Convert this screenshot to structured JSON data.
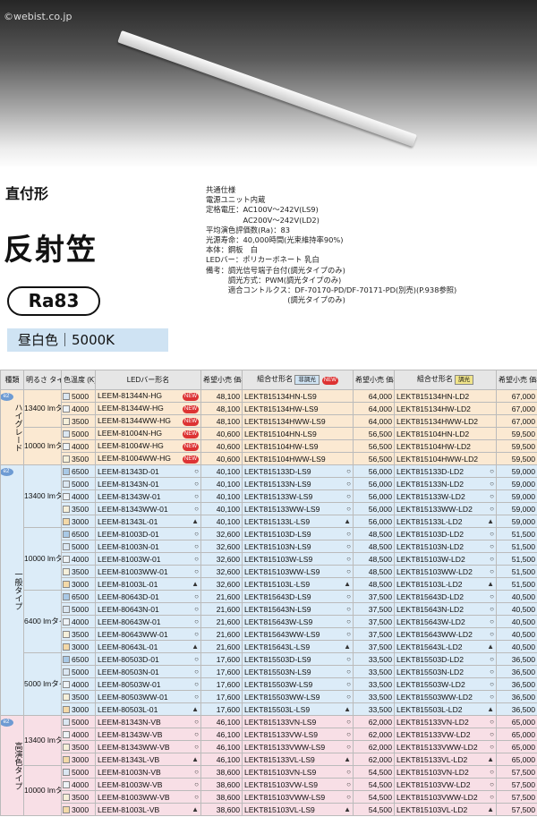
{
  "watermark": "©webist.co.jp",
  "mount_type": "直付形",
  "title": "反射笠",
  "ra": "Ra83",
  "color_label": "昼白色｜5000K",
  "specs": [
    "共通仕様",
    "電源ユニット内蔵",
    "定格電圧：AC100V～242V(LS9)",
    "　　　　　AC200V～242V(LD2)",
    "平均演色評価数(Ra)：83",
    "光源寿命：40,000時間(光束維持率90%)",
    "本体：鋼板　白",
    "LEDバー：ポリカーボネート 乳白",
    "備考：調光信号端子台付(調光タイプのみ)",
    "　　　調光方式：PWM(調光タイプのみ)",
    "　　　適合コントルクス：DF-70170-PD/DF-70171-PD(別売)(P.938参照)",
    "　　　　　　　　　　　(調光タイプのみ)"
  ],
  "headers": {
    "kind": "種類",
    "lm": "明るさ タイプ※1",
    "cct": "色温度 (K)",
    "bar": "LEDバー形名",
    "price": "希望小売 価格(円)",
    "combo": "組合せ形名",
    "nondim": "非調光",
    "new": "NEW",
    "dim": "調光"
  },
  "colors": {
    "6500": "#a9c9e6",
    "5000": "#dbe7f2",
    "4000": "#eef3f7",
    "3500": "#f6f0da",
    "3000": "#f4d9a8"
  },
  "rows": [
    {
      "cct": "5000",
      "bar": "LEEM-81344N-HG",
      "m": "new",
      "p1": "48,100",
      "c1": "LEKT815134HN-LS9",
      "p2": "64,000",
      "c2": "LEKT815134HN-LD2",
      "p3": "67,000"
    },
    {
      "cct": "4000",
      "bar": "LEEM-81344W-HG",
      "m": "new",
      "p1": "48,100",
      "c1": "LEKT815134HW-LS9",
      "p2": "64,000",
      "c2": "LEKT815134HW-LD2",
      "p3": "67,000"
    },
    {
      "cct": "3500",
      "bar": "LEEM-81344WW-HG",
      "m": "new",
      "p1": "48,100",
      "c1": "LEKT815134HWW-LS9",
      "p2": "64,000",
      "c2": "LEKT815134HWW-LD2",
      "p3": "67,000"
    },
    {
      "cct": "5000",
      "bar": "LEEM-81004N-HG",
      "m": "new",
      "p1": "40,600",
      "c1": "LEKT815104HN-LS9",
      "p2": "56,500",
      "c2": "LEKT815104HN-LD2",
      "p3": "59,500"
    },
    {
      "cct": "4000",
      "bar": "LEEM-81004W-HG",
      "m": "new",
      "p1": "40,600",
      "c1": "LEKT815104HW-LS9",
      "p2": "56,500",
      "c2": "LEKT815104HW-LD2",
      "p3": "59,500"
    },
    {
      "cct": "3500",
      "bar": "LEEM-81004WW-HG",
      "m": "new",
      "p1": "40,600",
      "c1": "LEKT815104HWW-LS9",
      "p2": "56,500",
      "c2": "LEKT815104HWW-LD2",
      "p3": "59,500"
    },
    {
      "cct": "6500",
      "bar": "LEEM-81343D-01",
      "m": "○",
      "p1": "40,100",
      "c1": "LEKT815133D-LS9",
      "p2": "56,000",
      "c2": "LEKT815133D-LD2",
      "p3": "59,000"
    },
    {
      "cct": "5000",
      "bar": "LEEM-81343N-01",
      "m": "○",
      "p1": "40,100",
      "c1": "LEKT815133N-LS9",
      "p2": "56,000",
      "c2": "LEKT815133N-LD2",
      "p3": "59,000"
    },
    {
      "cct": "4000",
      "bar": "LEEM-81343W-01",
      "m": "○",
      "p1": "40,100",
      "c1": "LEKT815133W-LS9",
      "p2": "56,000",
      "c2": "LEKT815133W-LD2",
      "p3": "59,000"
    },
    {
      "cct": "3500",
      "bar": "LEEM-81343WW-01",
      "m": "○",
      "p1": "40,100",
      "c1": "LEKT815133WW-LS9",
      "p2": "56,000",
      "c2": "LEKT815133WW-LD2",
      "p3": "59,000"
    },
    {
      "cct": "3000",
      "bar": "LEEM-81343L-01",
      "m": "▲",
      "p1": "40,100",
      "c1": "LEKT815133L-LS9",
      "p2": "56,000",
      "c2": "LEKT815133L-LD2",
      "p3": "59,000"
    },
    {
      "cct": "6500",
      "bar": "LEEM-81003D-01",
      "m": "○",
      "p1": "32,600",
      "c1": "LEKT815103D-LS9",
      "p2": "48,500",
      "c2": "LEKT815103D-LD2",
      "p3": "51,500"
    },
    {
      "cct": "5000",
      "bar": "LEEM-81003N-01",
      "m": "○",
      "p1": "32,600",
      "c1": "LEKT815103N-LS9",
      "p2": "48,500",
      "c2": "LEKT815103N-LD2",
      "p3": "51,500"
    },
    {
      "cct": "4000",
      "bar": "LEEM-81003W-01",
      "m": "○",
      "p1": "32,600",
      "c1": "LEKT815103W-LS9",
      "p2": "48,500",
      "c2": "LEKT815103W-LD2",
      "p3": "51,500"
    },
    {
      "cct": "3500",
      "bar": "LEEM-81003WW-01",
      "m": "○",
      "p1": "32,600",
      "c1": "LEKT815103WW-LS9",
      "p2": "48,500",
      "c2": "LEKT815103WW-LD2",
      "p3": "51,500"
    },
    {
      "cct": "3000",
      "bar": "LEEM-81003L-01",
      "m": "▲",
      "p1": "32,600",
      "c1": "LEKT815103L-LS9",
      "p2": "48,500",
      "c2": "LEKT815103L-LD2",
      "p3": "51,500"
    },
    {
      "cct": "6500",
      "bar": "LEEM-80643D-01",
      "m": "○",
      "p1": "21,600",
      "c1": "LEKT815643D-LS9",
      "p2": "37,500",
      "c2": "LEKT815643D-LD2",
      "p3": "40,500"
    },
    {
      "cct": "5000",
      "bar": "LEEM-80643N-01",
      "m": "○",
      "p1": "21,600",
      "c1": "LEKT815643N-LS9",
      "p2": "37,500",
      "c2": "LEKT815643N-LD2",
      "p3": "40,500"
    },
    {
      "cct": "4000",
      "bar": "LEEM-80643W-01",
      "m": "○",
      "p1": "21,600",
      "c1": "LEKT815643W-LS9",
      "p2": "37,500",
      "c2": "LEKT815643W-LD2",
      "p3": "40,500"
    },
    {
      "cct": "3500",
      "bar": "LEEM-80643WW-01",
      "m": "○",
      "p1": "21,600",
      "c1": "LEKT815643WW-LS9",
      "p2": "37,500",
      "c2": "LEKT815643WW-LD2",
      "p3": "40,500"
    },
    {
      "cct": "3000",
      "bar": "LEEM-80643L-01",
      "m": "▲",
      "p1": "21,600",
      "c1": "LEKT815643L-LS9",
      "p2": "37,500",
      "c2": "LEKT815643L-LD2",
      "p3": "40,500"
    },
    {
      "cct": "6500",
      "bar": "LEEM-80503D-01",
      "m": "○",
      "p1": "17,600",
      "c1": "LEKT815503D-LS9",
      "p2": "33,500",
      "c2": "LEKT815503D-LD2",
      "p3": "36,500"
    },
    {
      "cct": "5000",
      "bar": "LEEM-80503N-01",
      "m": "○",
      "p1": "17,600",
      "c1": "LEKT815503N-LS9",
      "p2": "33,500",
      "c2": "LEKT815503N-LD2",
      "p3": "36,500"
    },
    {
      "cct": "4000",
      "bar": "LEEM-80503W-01",
      "m": "○",
      "p1": "17,600",
      "c1": "LEKT815503W-LS9",
      "p2": "33,500",
      "c2": "LEKT815503W-LD2",
      "p3": "36,500"
    },
    {
      "cct": "3500",
      "bar": "LEEM-80503WW-01",
      "m": "○",
      "p1": "17,600",
      "c1": "LEKT815503WW-LS9",
      "p2": "33,500",
      "c2": "LEKT815503WW-LD2",
      "p3": "36,500"
    },
    {
      "cct": "3000",
      "bar": "LEEM-80503L-01",
      "m": "▲",
      "p1": "17,600",
      "c1": "LEKT815503L-LS9",
      "p2": "33,500",
      "c2": "LEKT815503L-LD2",
      "p3": "36,500"
    },
    {
      "cct": "5000",
      "bar": "LEEM-81343N-VB",
      "m": "○",
      "p1": "46,100",
      "c1": "LEKT815133VN-LS9",
      "p2": "62,000",
      "c2": "LEKT815133VN-LD2",
      "p3": "65,000"
    },
    {
      "cct": "4000",
      "bar": "LEEM-81343W-VB",
      "m": "○",
      "p1": "46,100",
      "c1": "LEKT815133VW-LS9",
      "p2": "62,000",
      "c2": "LEKT815133VW-LD2",
      "p3": "65,000"
    },
    {
      "cct": "3500",
      "bar": "LEEM-81343WW-VB",
      "m": "○",
      "p1": "46,100",
      "c1": "LEKT815133VWW-LS9",
      "p2": "62,000",
      "c2": "LEKT815133VWW-LD2",
      "p3": "65,000"
    },
    {
      "cct": "3000",
      "bar": "LEEM-81343L-VB",
      "m": "▲",
      "p1": "46,100",
      "c1": "LEKT815133VL-LS9",
      "p2": "62,000",
      "c2": "LEKT815133VL-LD2",
      "p3": "65,000"
    },
    {
      "cct": "5000",
      "bar": "LEEM-81003N-VB",
      "m": "○",
      "p1": "38,600",
      "c1": "LEKT815103VN-LS9",
      "p2": "54,500",
      "c2": "LEKT815103VN-LD2",
      "p3": "57,500"
    },
    {
      "cct": "4000",
      "bar": "LEEM-81003W-VB",
      "m": "○",
      "p1": "38,600",
      "c1": "LEKT815103VW-LS9",
      "p2": "54,500",
      "c2": "LEKT815103VW-LD2",
      "p3": "57,500"
    },
    {
      "cct": "3500",
      "bar": "LEEM-81003WW-VB",
      "m": "○",
      "p1": "38,600",
      "c1": "LEKT815103VWW-LS9",
      "p2": "54,500",
      "c2": "LEKT815103VWW-LD2",
      "p3": "57,500"
    },
    {
      "cct": "3000",
      "bar": "LEEM-81003L-VB",
      "m": "▲",
      "p1": "38,600",
      "c1": "LEKT815103VL-LS9",
      "p2": "54,500",
      "c2": "LEKT815103VL-LD2",
      "p3": "57,500"
    }
  ],
  "kinds": [
    {
      "label": "ハイグレード",
      "start": 0,
      "span": 6,
      "bg": "#fbe9d2"
    },
    {
      "label": "一般タイプ",
      "start": 6,
      "span": 20,
      "bg": "#dcecf8"
    },
    {
      "label": "高演色タイプ",
      "start": 26,
      "span": 8,
      "bg": "#f8dfe6"
    }
  ],
  "kind_badge": "e2",
  "lm_groups": [
    {
      "label": "13400 lmタイプ",
      "start": 0,
      "span": 3
    },
    {
      "label": "10000 lmタイプ",
      "start": 3,
      "span": 3
    },
    {
      "label": "13400 lmタイプ",
      "start": 6,
      "span": 5
    },
    {
      "label": "10000 lmタイプ",
      "start": 11,
      "span": 5
    },
    {
      "label": "6400 lmタイプ",
      "start": 16,
      "span": 5
    },
    {
      "label": "5000 lmタイプ",
      "start": 21,
      "span": 5
    },
    {
      "label": "13400 lmタイプ",
      "start": 26,
      "span": 4
    },
    {
      "label": "10000 lmタイプ",
      "start": 30,
      "span": 4
    }
  ]
}
